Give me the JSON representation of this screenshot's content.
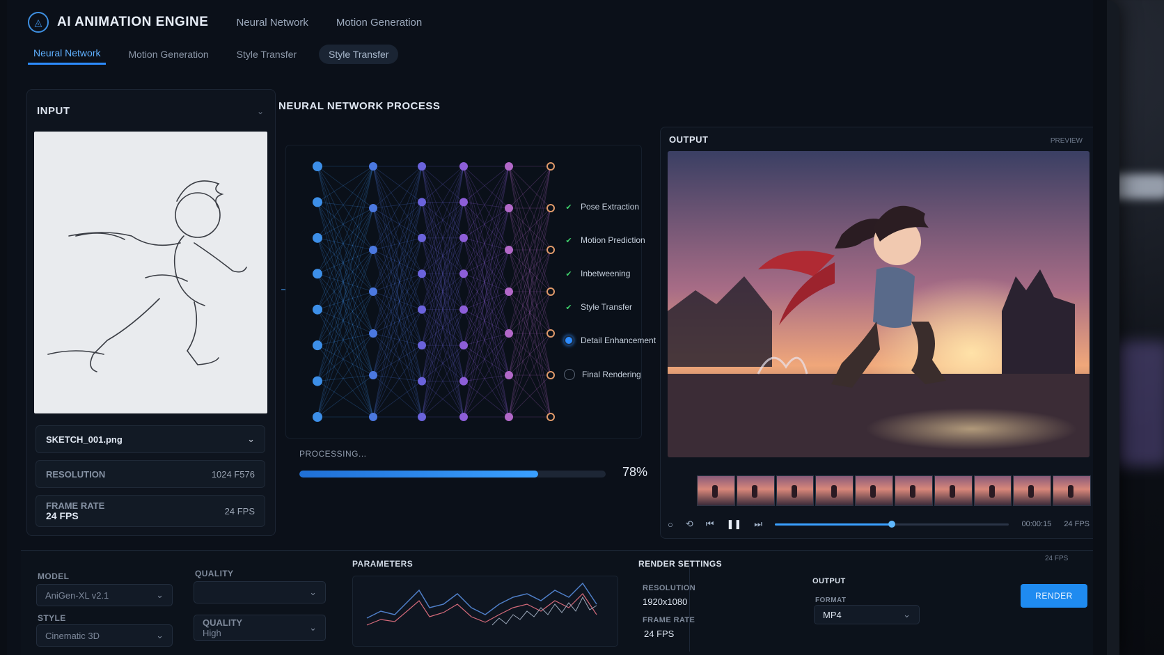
{
  "app": {
    "title": "AI ANIMATION ENGINE",
    "top_nav": [
      "Neural Network",
      "Motion Generation"
    ]
  },
  "tabs": [
    {
      "label": "Neural Network",
      "active": true
    },
    {
      "label": "Motion Generation",
      "active": false
    },
    {
      "label": "Style Transfer",
      "active": false
    },
    {
      "label": "Style Transfer",
      "active": false,
      "pill": true
    }
  ],
  "input": {
    "title": "INPUT",
    "file_name": "SKETCH_001.png",
    "resolution_label": "RESOLUTION",
    "resolution_value": "1024 F576",
    "frame_rate_label": "FRAME RATE",
    "frame_rate_value": "24 FPS",
    "frame_rate_value_right": "24 FPS"
  },
  "network": {
    "title": "NEURAL NETWORK PROCESS",
    "steps": [
      {
        "label": "Pose Extraction",
        "status": "done"
      },
      {
        "label": "Motion Prediction",
        "status": "done"
      },
      {
        "label": "Inbetweening",
        "status": "done"
      },
      {
        "label": "Style Transfer",
        "status": "done"
      },
      {
        "label": "Detail Enhancement",
        "status": "active"
      },
      {
        "label": "Final Rendering",
        "status": "pending"
      }
    ],
    "processing_label": "PROCESSING...",
    "progress_percent": 78,
    "progress_text": "78%"
  },
  "output": {
    "title": "OUTPUT",
    "preview_label": "PREVIEW",
    "timecode": "00:00:15",
    "fps": "24 FPS",
    "frame_count": 10,
    "scrub_position": 0.5
  },
  "bottom": {
    "model_label": "MODEL",
    "model_value": "AniGen-XL v2.1",
    "style_label": "STYLE",
    "style_value": "Cinematic 3D",
    "quality_label": "QUALITY",
    "quality_value": "High",
    "parameters_label": "PARAMETERS",
    "render_settings_label": "RENDER SETTINGS",
    "resolution_label": "RESOLUTION",
    "resolution_value": "1920x1080",
    "frame_rate_label": "FRAME RATE",
    "frame_rate_value": "24 FPS",
    "output_label": "OUTPUT",
    "format_label": "FORMAT",
    "format_value": "MP4",
    "render_button": "RENDER",
    "fps_tag": "24 FPS"
  },
  "colors": {
    "accent": "#2d8cff",
    "done": "#3fd06b",
    "bg": "#0b1019"
  },
  "icons": [
    "logo-icon",
    "chevron-down-icon",
    "check-icon",
    "play-icon",
    "pause-icon",
    "skip-icon",
    "arrow-right-icon"
  ]
}
